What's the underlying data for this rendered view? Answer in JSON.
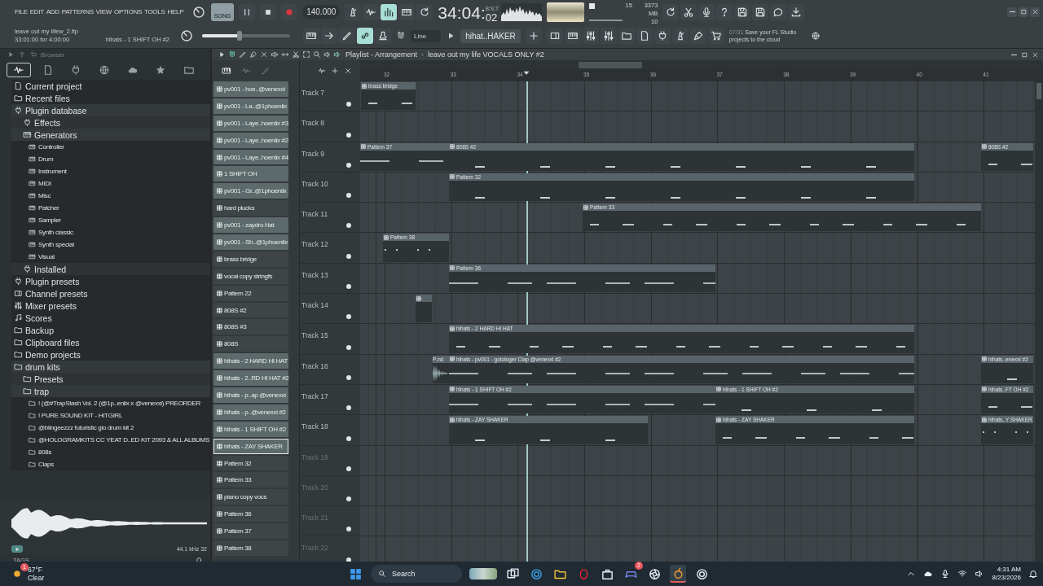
{
  "menu": [
    "FILE",
    "EDIT",
    "ADD",
    "PATTERNS",
    "VIEW",
    "OPTIONS",
    "TOOLS",
    "HELP"
  ],
  "hint_panel": {
    "file": "leave out my lifew_2.flp",
    "range": "33:01:00 for 4:00:00",
    "pattern": "hihats - 1 SHIFT OH #2"
  },
  "transport": {
    "song_label": "SONG",
    "song_mode": true,
    "tempo": "140.000",
    "master_volume": {
      "level": 0.43
    }
  },
  "time": {
    "main": "34:04:",
    "ticks": "02",
    "format": "B:S:T"
  },
  "cpu": {
    "polyphony": "15",
    "memory": "3373 MB",
    "cpu": "10"
  },
  "snap": "Line",
  "current_pattern": "hihat..HAKER",
  "news": {
    "counter": "07/31",
    "text": "Save your FL Studio projects to the cloud"
  },
  "browser": {
    "title": "Browser",
    "tree": [
      {
        "label": "Current project",
        "kind": "file"
      },
      {
        "label": "Recent files",
        "kind": "folder"
      },
      {
        "label": "Plugin database",
        "kind": "plugin",
        "children": [
          {
            "label": "Effects",
            "kind": "effect"
          },
          {
            "label": "Generators",
            "kind": "generator",
            "children": [
              {
                "label": "Controller",
                "kind": "generator"
              },
              {
                "label": "Drum",
                "kind": "generator"
              },
              {
                "label": "Instrument",
                "kind": "generator"
              },
              {
                "label": "MIDI",
                "kind": "generator"
              },
              {
                "label": "Misc",
                "kind": "generator"
              },
              {
                "label": "Patcher",
                "kind": "generator"
              },
              {
                "label": "Sampler",
                "kind": "generator"
              },
              {
                "label": "Synth classic",
                "kind": "generator"
              },
              {
                "label": "Synth special",
                "kind": "generator"
              },
              {
                "label": "Visual",
                "kind": "generator"
              }
            ]
          },
          {
            "label": "Installed",
            "kind": "plugin"
          }
        ]
      },
      {
        "label": "Plugin presets",
        "kind": "plugin"
      },
      {
        "label": "Channel presets",
        "kind": "channel"
      },
      {
        "label": "Mixer presets",
        "kind": "mixer"
      },
      {
        "label": "Scores",
        "kind": "score"
      },
      {
        "label": "Backup",
        "kind": "folder"
      },
      {
        "label": "Clipboard files",
        "kind": "folder"
      },
      {
        "label": "Demo projects",
        "kind": "folder"
      },
      {
        "label": "drum kits",
        "kind": "folder",
        "children": [
          {
            "label": "Presets",
            "kind": "folder"
          },
          {
            "label": "trap",
            "kind": "folder",
            "children": [
              {
                "label": "! (@#TrapStash Vol. 2 (@1p..eniix x @venexxi) PREORDER",
                "kind": "folder"
              },
              {
                "label": "! PURE SOUND KIT - HITGIRL",
                "kind": "folder"
              },
              {
                "label": "@blingeezzz futuristic glo drum kit 2",
                "kind": "folder"
              },
              {
                "label": "@HOLOGRAMKITS CC YEAT D..ED KIT 2093 & ALL ALBUMS",
                "kind": "folder"
              },
              {
                "label": "808s",
                "kind": "folder"
              },
              {
                "label": "Claps",
                "kind": "folder"
              }
            ]
          }
        ]
      }
    ],
    "sample_info": "44.1 kHz 32",
    "tags_label": "TAGS"
  },
  "patterns": [
    {
      "name": "pv001 - hoe..@venexxi",
      "color": "#5c6a6b",
      "selected": false
    },
    {
      "name": "pv001 - La..@1phoeniix",
      "color": "#5c6a6b",
      "selected": false
    },
    {
      "name": "pv001 - Laye..hoeniix #3",
      "color": "#5c6a6b",
      "selected": false
    },
    {
      "name": "pv001 - Laye..hoeniix #2",
      "color": "#5c6a6b",
      "selected": false
    },
    {
      "name": "pv001 - Laye..hoeniix #4",
      "color": "#5c6a6b",
      "selected": false
    },
    {
      "name": "1 SHIFT OH",
      "color": "#5c6a6b",
      "selected": false
    },
    {
      "name": "pv001 - Gr..@1phoeniix",
      "color": "#5c6a6b",
      "selected": false
    },
    {
      "name": "hard plucks",
      "color": "#3f4547",
      "selected": false
    },
    {
      "name": "pv001 - zaydro Hat",
      "color": "#5c6a6b",
      "selected": false
    },
    {
      "name": "pv001 - Sh..@1phoeniix",
      "color": "#5c6a6b",
      "selected": false
    },
    {
      "name": "brass bridge",
      "color": "#3f4547",
      "selected": false
    },
    {
      "name": "vocal copy stringfs",
      "color": "#3f4547",
      "selected": false
    },
    {
      "name": "Pattern 22",
      "color": "#3f4547",
      "selected": false
    },
    {
      "name": "808S #2",
      "color": "#3f4547",
      "selected": false
    },
    {
      "name": "808S #3",
      "color": "#3f4547",
      "selected": false
    },
    {
      "name": "808S",
      "color": "#3f4547",
      "selected": false
    },
    {
      "name": "hihats - 2 HARD HI HAT",
      "color": "#5c6a6b",
      "selected": false
    },
    {
      "name": "hihats - 2..RD HI HAT #2",
      "color": "#5c6a6b",
      "selected": false
    },
    {
      "name": "hihats - p..ap @venexxi",
      "color": "#5c6a6b",
      "selected": false
    },
    {
      "name": "hihats - p..@venexxi #2",
      "color": "#5c6a6b",
      "selected": false
    },
    {
      "name": "hihats - 1 SHIFT OH #2",
      "color": "#5c6a6b",
      "selected": false
    },
    {
      "name": "hihats - ZAY SHAKER",
      "color": "#5c6a6b",
      "selected": true
    },
    {
      "name": "Pattern 32",
      "color": "#3f4547",
      "selected": false
    },
    {
      "name": "Pattern 33",
      "color": "#3f4547",
      "selected": false
    },
    {
      "name": "piano copy vocs",
      "color": "#3f4547",
      "selected": false
    },
    {
      "name": "Pattern 36",
      "color": "#3f4547",
      "selected": false
    },
    {
      "name": "Pattern 37",
      "color": "#3f4547",
      "selected": false
    },
    {
      "name": "Pattern 38",
      "color": "#3f4547",
      "selected": false
    }
  ],
  "playlist": {
    "title": "Playlist - Arrangement",
    "separator": "›",
    "arrangement": "leave out my life VOCALS ONLY #2",
    "ruler": [
      "32",
      "33",
      "34",
      "35",
      "36",
      "37",
      "38",
      "39",
      "40",
      "41"
    ],
    "tracks": [
      {
        "name": "Track 7",
        "dimmed": false,
        "clips": [
          {
            "kind": "pattern",
            "label": "brass bridge"
          }
        ]
      },
      {
        "name": "Track 8",
        "dimmed": false
      },
      {
        "name": "Track 9",
        "dimmed": false,
        "clips": [
          {
            "kind": "pattern",
            "label": "Pattern 37"
          },
          {
            "kind": "pattern",
            "label": "808S #2"
          },
          {
            "kind": "pattern",
            "label": "808S #2"
          }
        ]
      },
      {
        "name": "Track 10",
        "dimmed": false,
        "clips": [
          {
            "kind": "pattern",
            "label": "Pattern 32"
          }
        ]
      },
      {
        "name": "Track 11",
        "dimmed": false,
        "clips": [
          {
            "kind": "pattern",
            "label": "Pattern 33"
          }
        ]
      },
      {
        "name": "Track 12",
        "dimmed": false,
        "clips": [
          {
            "kind": "pattern",
            "label": "Pattern 38"
          }
        ]
      },
      {
        "name": "Track 13",
        "dimmed": false,
        "clips": [
          {
            "kind": "pattern",
            "label": "Pattern 36"
          }
        ]
      },
      {
        "name": "Track 14",
        "dimmed": false,
        "clips": [
          {
            "kind": "pattern"
          }
        ]
      },
      {
        "name": "Track 15",
        "dimmed": false,
        "clips": [
          {
            "kind": "pattern",
            "label": "hihats - 2 HARD HI HAT"
          }
        ]
      },
      {
        "name": "Track 16",
        "dimmed": false,
        "clips": [
          {
            "kind": "audio",
            "label": "P..nd"
          },
          {
            "kind": "pattern",
            "label": "hihats - pv001 - gotoluger Clap @venexxi #2"
          },
          {
            "kind": "pattern",
            "label": "hihats..enexxi #2"
          }
        ]
      },
      {
        "name": "Track 17",
        "dimmed": false,
        "clips": [
          {
            "kind": "pattern",
            "label": "hihats - 1 SHIFT OH #2"
          },
          {
            "kind": "pattern",
            "label": "hihats - 1 SHIFT OH #2"
          },
          {
            "kind": "pattern",
            "label": "hihats..FT OH #2"
          }
        ]
      },
      {
        "name": "Track 18",
        "dimmed": false,
        "clips": [
          {
            "kind": "pattern",
            "label": "hihats - ZAY SHAKER"
          },
          {
            "kind": "pattern",
            "label": "hihats - ZAY SHAKER"
          },
          {
            "kind": "pattern",
            "label": "hihats..Y SHAKER"
          }
        ]
      },
      {
        "name": "Track 19",
        "dimmed": true
      },
      {
        "name": "Track 20",
        "dimmed": true
      },
      {
        "name": "Track 21",
        "dimmed": true
      },
      {
        "name": "Track 22",
        "dimmed": true
      }
    ]
  },
  "taskbar": {
    "weather": {
      "temp": "67°F",
      "condition": "Clear",
      "badge": "1"
    },
    "search_placeholder": "Search",
    "apps": [
      {
        "kind": "taskview"
      },
      {
        "kind": "browser"
      },
      {
        "kind": "files"
      },
      {
        "kind": "opera"
      },
      {
        "kind": "store"
      },
      {
        "kind": "discord",
        "badge": "2"
      },
      {
        "kind": "obs"
      },
      {
        "kind": "fl",
        "selected": true
      },
      {
        "kind": "spiral"
      }
    ],
    "clock": {
      "time": "4:31 AM",
      "date": "8/23/2026"
    }
  }
}
